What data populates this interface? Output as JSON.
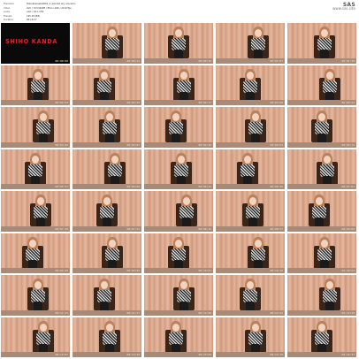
{
  "meta": [
    {
      "key": "Filename",
      "value": "thehubsheets0002_2_kanda5 shy are.wmv"
    },
    {
      "key": "Video",
      "value": "AVC / YUV420P8 / 854 x 480 / 29.97fps"
    },
    {
      "key": "Audio",
      "value": "AAC / 44.1 kHz"
    },
    {
      "key": "Filesize",
      "value": "195.93 MiB"
    },
    {
      "key": "Duration",
      "value": "00:18:37"
    },
    {
      "key": "Resolution",
      "value": "1280 x 720"
    }
  ],
  "logo": {
    "mark": "SAS",
    "site": "www.sas.site"
  },
  "title_card": {
    "text": "SHIHO KANDA",
    "timestamp": "00:00:00"
  },
  "timestamps": [
    "00:00:22",
    "00:00:45",
    "00:01:07",
    "00:01:30",
    "00:01:52",
    "00:02:15",
    "00:02:37",
    "00:03:00",
    "00:03:22",
    "00:03:45",
    "00:04:07",
    "00:04:30",
    "00:04:52",
    "00:05:15",
    "00:05:37",
    "00:06:00",
    "00:06:22",
    "00:06:45",
    "00:07:07",
    "00:07:30",
    "00:07:52",
    "00:08:15",
    "00:08:37",
    "00:09:00",
    "00:09:22",
    "00:09:45",
    "00:10:07",
    "00:10:30",
    "00:10:52",
    "00:11:15",
    "00:11:37",
    "00:12:00",
    "00:12:22",
    "00:12:45",
    "00:13:07",
    "00:13:30",
    "00:13:52",
    "00:14:15",
    "00:14:37"
  ]
}
